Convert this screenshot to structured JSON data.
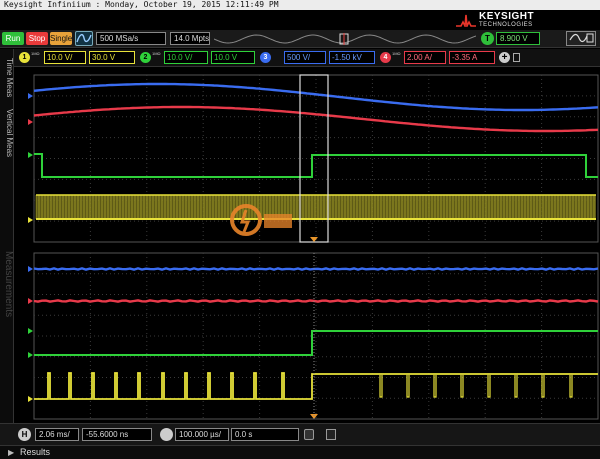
{
  "titlebar": {
    "text": "Keysight Infiniium : Monday, October 19, 2015 12:11:49 PM"
  },
  "brand": {
    "name": "KEYSIGHT",
    "sub": "TECHNOLOGIES"
  },
  "toolbar": {
    "run_label": "Run",
    "stop_label": "Stop",
    "single_label": "Single",
    "sample_rate": "500 MSa/s",
    "memory_depth": "14.0 Mpts",
    "trigger_source": "T",
    "trigger_level": "8.900 V"
  },
  "channels": [
    {
      "number": "1",
      "coupling": "1MΩ",
      "scale": "10.0 V/",
      "offset": "30.0 V",
      "color": "#e8e23a"
    },
    {
      "number": "2",
      "coupling": "1MΩ",
      "scale": "10.0 V/",
      "offset": "10.0 V",
      "color": "#2fd13a"
    },
    {
      "number": "3",
      "coupling": "",
      "scale": "500 V/",
      "offset": "-1.50 kV",
      "color": "#3a6cf0"
    },
    {
      "number": "4",
      "coupling": "1MΩ",
      "scale": "2.00 A/",
      "offset": "-3.35 A",
      "color": "#e83a4a"
    }
  ],
  "sidetabs": {
    "time_meas": "Time Meas",
    "vertical_meas": "Vertical Meas",
    "measurements": "Measurements"
  },
  "horizontal": {
    "h_label": "H",
    "timebase": "2.06 ms/",
    "delay": "-55.6000 ns",
    "zoom_scale": "100.000 µs/",
    "zoom_delay": "0.0 s"
  },
  "results": {
    "label": "Results"
  },
  "colors": {
    "ch1": "#e8e23a",
    "ch2": "#2fd13a",
    "ch3": "#3a6cf0",
    "ch4": "#e83a4a",
    "grid": "#3a3a3a",
    "zoom_box": "#dddddd"
  }
}
